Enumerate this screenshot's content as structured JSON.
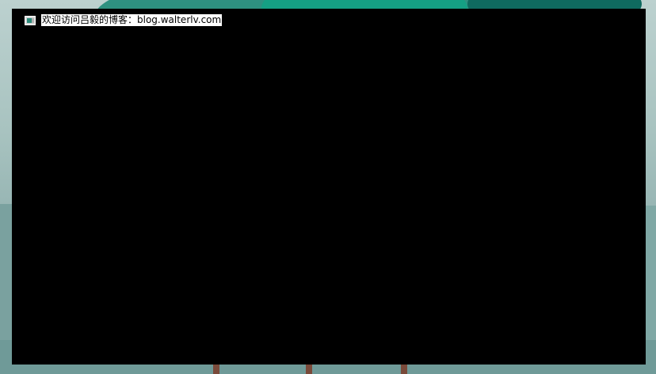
{
  "window": {
    "title": "欢迎访问吕毅的博客：blog.walterlv.com",
    "icon": "console-app-icon",
    "background_color": "#000000"
  },
  "wallpaper": {
    "colors": {
      "sky": "#bcd1cf",
      "teal": "#1f8a78",
      "teal_light": "#15a084",
      "teal_dark": "#0f6a5f",
      "ground": "#7fa8a5",
      "post": "#7a4a3a"
    }
  }
}
